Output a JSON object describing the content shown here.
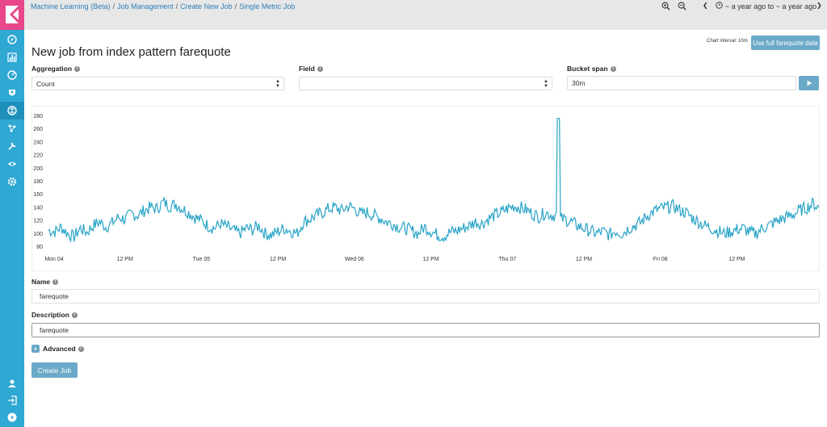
{
  "breadcrumb": {
    "items": [
      "Machine Learning (Beta)",
      "Job Management",
      "Create New Job",
      "Single Metric Job"
    ]
  },
  "topbar": {
    "time_range": "~ a year ago to ~ a year ago",
    "icons": [
      "zoom-in-icon",
      "zoom-out-icon",
      "chevron-left-icon",
      "clock-icon",
      "chevron-right-icon"
    ]
  },
  "sidebar": {
    "items": [
      "discover-icon",
      "visualize-icon",
      "dashboard-icon",
      "timelion-icon",
      "machine-learning-icon",
      "graph-icon",
      "dev-tools-icon",
      "monitoring-icon",
      "management-icon"
    ],
    "bottom": [
      "user-icon",
      "logout-icon",
      "collapse-icon"
    ]
  },
  "page": {
    "title": "New job from index pattern farequote",
    "chart_interval": "Chart interval: 10m",
    "use_full_button": "Use full farequote data"
  },
  "form": {
    "aggregation": {
      "label": "Aggregation",
      "value": "Count"
    },
    "field": {
      "label": "Field",
      "value": ""
    },
    "bucket_span": {
      "label": "Bucket span",
      "value": "30m"
    },
    "name": {
      "label": "Name",
      "value": "farequote"
    },
    "description": {
      "label": "Description",
      "value": "farequote"
    },
    "advanced": {
      "label": "Advanced"
    },
    "create_button": "Create Job"
  },
  "colors": {
    "accent": "#2fa8d4",
    "logo": "#e8488b",
    "line": "#29a4c6",
    "button": "#6ba9c8"
  },
  "chart_data": {
    "type": "line",
    "title": "",
    "xlabel": "",
    "ylabel": "",
    "x_ticks": [
      "Mon 04",
      "12 PM",
      "Tue 05",
      "12 PM",
      "Wed 06",
      "12 PM",
      "Thu 07",
      "12 PM",
      "Fri 08",
      "12 PM"
    ],
    "y_ticks": [
      80,
      100,
      120,
      140,
      160,
      180,
      200,
      220,
      240,
      260,
      280
    ],
    "ylim": [
      72,
      288
    ],
    "grid": false,
    "x_hours_range": [
      0,
      121
    ],
    "series": [
      {
        "values_hourly": [
          105,
          103,
          110,
          100,
          95,
          108,
          102,
          112,
          118,
          110,
          116,
          125,
          122,
          130,
          128,
          135,
          140,
          138,
          148,
          142,
          145,
          138,
          132,
          125,
          120,
          112,
          108,
          115,
          110,
          105,
          100,
          108,
          106,
          112,
          100,
          98,
          103,
          108,
          104,
          100,
          118,
          122,
          128,
          132,
          138,
          140,
          135,
          142,
          138,
          130,
          132,
          128,
          124,
          118,
          115,
          110,
          108,
          104,
          100,
          110,
          104,
          98,
          96,
          102,
          104,
          108,
          112,
          118,
          115,
          122,
          128,
          132,
          138,
          142,
          140,
          136,
          130,
          126,
          132,
          128,
          276,
          122,
          118,
          112,
          108,
          104,
          100,
          103,
          98,
          104,
          100,
          108,
          112,
          118,
          128,
          134,
          138,
          140,
          142,
          136,
          132,
          124,
          118,
          112,
          108,
          104,
          100,
          103,
          106,
          108,
          102,
          100,
          108,
          112,
          118,
          122,
          126,
          130,
          136,
          140,
          146,
          138
        ]
      }
    ]
  }
}
